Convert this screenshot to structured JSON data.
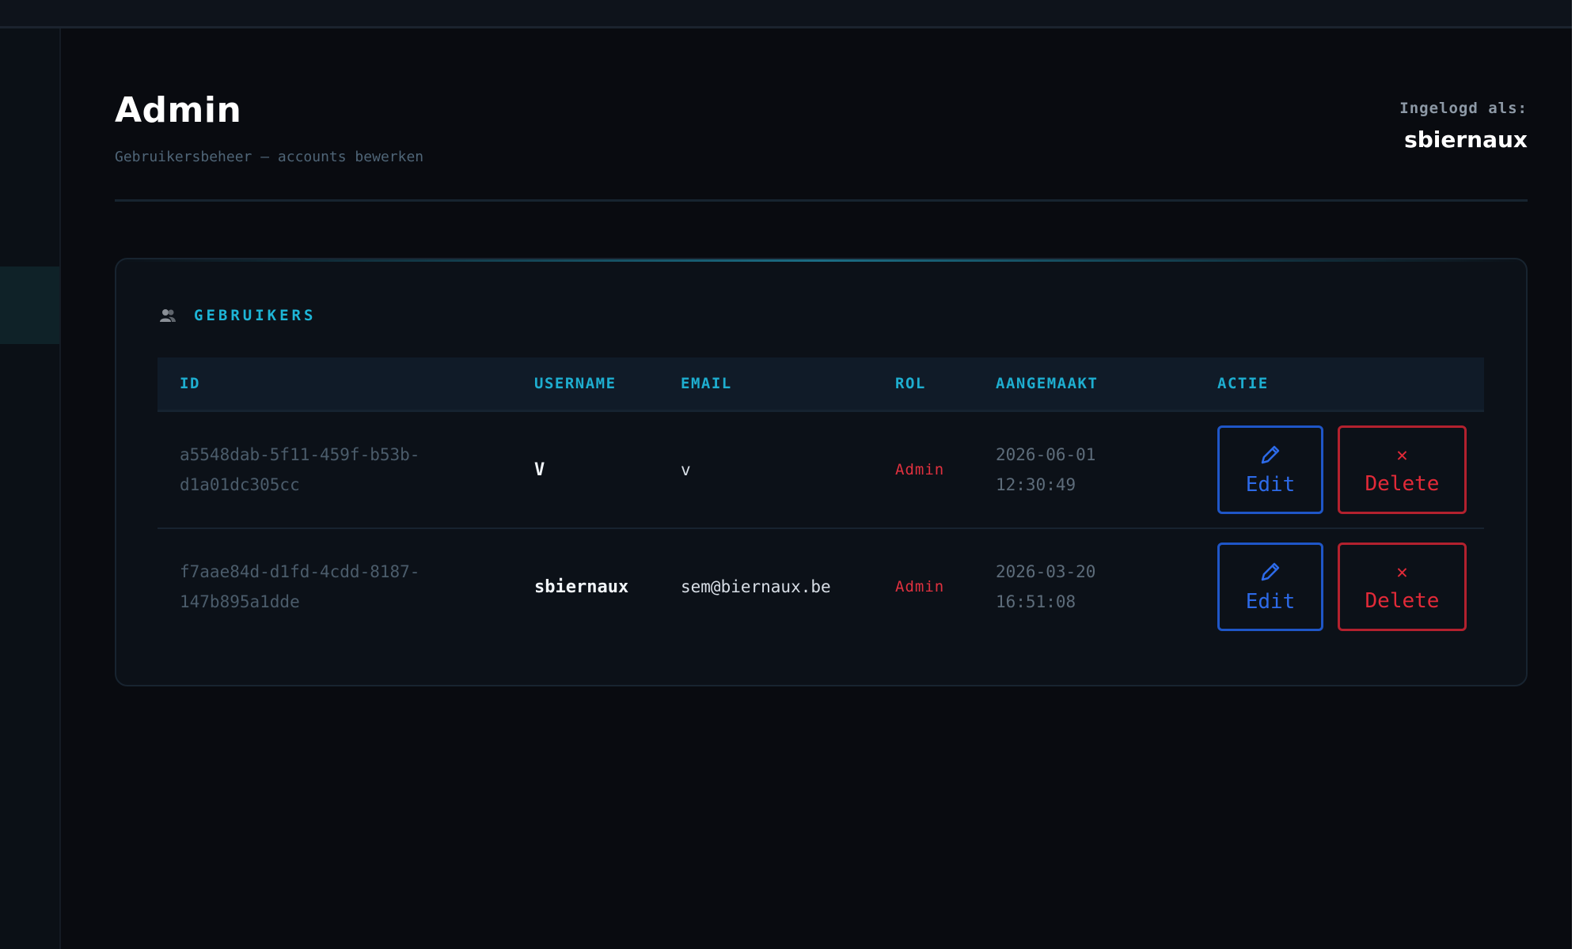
{
  "header": {
    "title": "Admin",
    "subtitle": "Gebruikersbeheer — accounts bewerken",
    "logged_in_label": "Ingelogd als:",
    "logged_in_user": "sbiernaux"
  },
  "users_section": {
    "title": "GEBRUIKERS",
    "icon": "users-icon",
    "columns": [
      "ID",
      "USERNAME",
      "EMAIL",
      "ROL",
      "AANGEMAAKT",
      "ACTIE"
    ],
    "rows": [
      {
        "id_line1": "a5548dab-5f11-459f-b53b-",
        "id_line2": "d1a01dc305cc",
        "username": "V",
        "email": "v",
        "role": "Admin",
        "created_date": "2026-06-01",
        "created_time": "12:30:49"
      },
      {
        "id_line1": "f7aae84d-d1fd-4cdd-8187-",
        "id_line2": "147b895a1dde",
        "username": "sbiernaux",
        "email": "sem@biernaux.be",
        "role": "Admin",
        "created_date": "2026-03-20",
        "created_time": "16:51:08"
      }
    ],
    "actions": {
      "edit_label": "Edit",
      "delete_label": "Delete",
      "edit_icon": "pencil-icon",
      "delete_icon": "x-icon"
    }
  },
  "colors": {
    "background": "#090b10",
    "accent": "#1eb5d6",
    "edit": "#2d6ae8",
    "danger": "#e22a38"
  }
}
